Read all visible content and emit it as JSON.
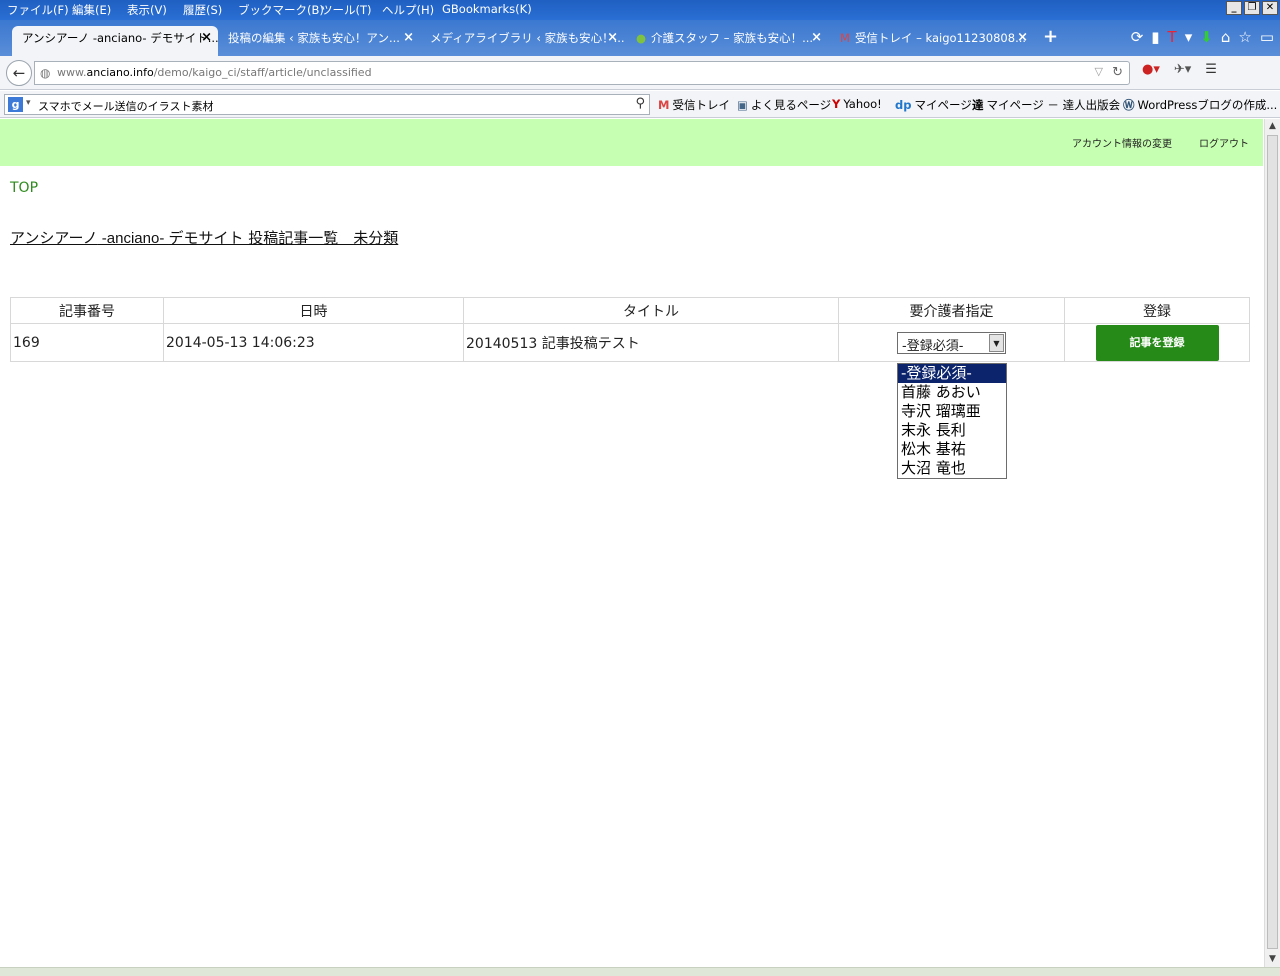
{
  "menubar": {
    "items": [
      "ファイル(F)",
      "編集(E)",
      "表示(V)",
      "履歴(S)",
      "ブックマーク(B)",
      "ツール(T)",
      "ヘルプ(H)",
      "GBookmarks(K)"
    ]
  },
  "tabs": [
    {
      "label": "アンシアーノ -anciano- デモサイト...",
      "active": true
    },
    {
      "label": "投稿の編集 ‹ 家族も安心！アン...",
      "active": false
    },
    {
      "label": "メディアライブラリ ‹ 家族も安心！...",
      "active": false
    },
    {
      "label": "介護スタッフ – 家族も安心！...",
      "active": false
    },
    {
      "label": "受信トレイ – kaigo11230808...",
      "active": false
    }
  ],
  "navbar": {
    "url_prefix": "www.",
    "url_domain": "anciano.info",
    "url_path": "/demo/kaigo_ci/staff/article/unclassified"
  },
  "search": {
    "query": "スマホでメール送信のイラスト素材"
  },
  "bookmarks": [
    "受信トレイ",
    "よく見るページ",
    "Yahoo!",
    "マイページ",
    "マイページ － 達人出版会",
    "WordPressブログの作成..."
  ],
  "header": {
    "account_link": "アカウント情報の変更",
    "logout_link": "ログアウト"
  },
  "breadcrumb": {
    "top": "TOP"
  },
  "page": {
    "title_part1": "アンシアーノ",
    "title_part2": " -anciano- ",
    "title_part3": "デモサイト 投稿記事一覧　未分類"
  },
  "table": {
    "headers": [
      "記事番号",
      "日時",
      "タイトル",
      "要介護者指定",
      "登録"
    ],
    "rows": [
      {
        "id": "169",
        "datetime": "2014-05-13 14:06:23",
        "title": "20140513 記事投稿テスト",
        "select_value": "-登録必須-",
        "button": "記事を登録"
      }
    ]
  },
  "dropdown": {
    "options": [
      "-登録必須-",
      "首藤 あおい",
      "寺沢 瑠璃亜",
      "末永 長利",
      "松木 基祐",
      "大沼 竜也"
    ]
  }
}
